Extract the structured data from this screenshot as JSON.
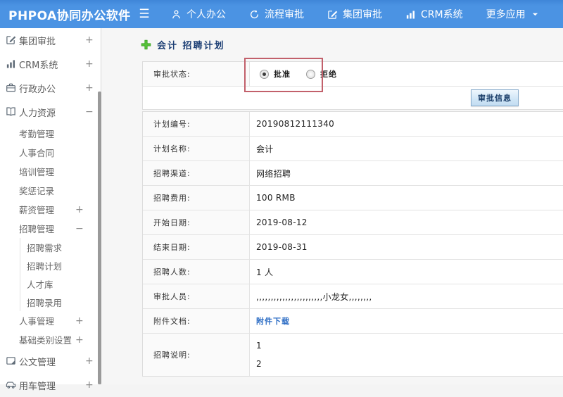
{
  "topbar": {
    "logo": "PHPOA协同办公软件",
    "items": [
      {
        "name": "personal-office",
        "label": "个人办公",
        "icon": "person-icon"
      },
      {
        "name": "workflow-approval",
        "label": "流程审批",
        "icon": "process-icon"
      },
      {
        "name": "group-approval",
        "label": "集团审批",
        "icon": "edit-square-icon"
      },
      {
        "name": "crm-system",
        "label": "CRM系统",
        "icon": "bar-chart-icon"
      },
      {
        "name": "more-apps",
        "label": "更多应用",
        "icon": "",
        "caret": true
      }
    ]
  },
  "sidebar": {
    "items": [
      {
        "name": "group-approval",
        "label": "集团审批",
        "icon": "edit-square-icon",
        "toggle": "+",
        "level": 0
      },
      {
        "name": "crm-system",
        "label": "CRM系统",
        "icon": "bar-chart-icon",
        "toggle": "+",
        "level": 0
      },
      {
        "name": "administration",
        "label": "行政办公",
        "icon": "briefcase-icon",
        "toggle": "+",
        "level": 0
      },
      {
        "name": "human-resources",
        "label": "人力资源",
        "icon": "book-icon",
        "toggle": "-",
        "level": 0
      },
      {
        "name": "attendance-mgmt",
        "label": "考勤管理",
        "level": 1
      },
      {
        "name": "hr-contract",
        "label": "人事合同",
        "level": 1
      },
      {
        "name": "training-mgmt",
        "label": "培训管理",
        "level": 1
      },
      {
        "name": "reward-records",
        "label": "奖惩记录",
        "level": 1
      },
      {
        "name": "salary-mgmt",
        "label": "薪资管理",
        "toggle": "+",
        "level": 1
      },
      {
        "name": "recruit-mgmt",
        "label": "招聘管理",
        "toggle": "-",
        "level": 1
      },
      {
        "name": "recruit-demand",
        "label": "招聘需求",
        "level": 2
      },
      {
        "name": "recruit-plan",
        "label": "招聘计划",
        "level": 2
      },
      {
        "name": "talent-pool",
        "label": "人才库",
        "level": 2
      },
      {
        "name": "recruit-hiring",
        "label": "招聘录用",
        "level": 2
      },
      {
        "name": "personnel-mgmt",
        "label": "人事管理",
        "toggle": "+",
        "level": 1
      },
      {
        "name": "base-category",
        "label": "基础类别设置",
        "toggle": "+",
        "level": 1
      },
      {
        "name": "document-mgmt",
        "label": "公文管理",
        "icon": "document-icon",
        "toggle": "+",
        "level": 0
      },
      {
        "name": "vehicle-mgmt",
        "label": "用车管理",
        "icon": "car-icon",
        "toggle": "+",
        "level": 0
      }
    ]
  },
  "main": {
    "title": "会计 招聘计划",
    "approval": {
      "label": "审批状态:",
      "options": [
        {
          "name": "approve",
          "label": "批准",
          "checked": true
        },
        {
          "name": "reject",
          "label": "拒绝",
          "checked": false
        }
      ],
      "button_label": "审批信息"
    },
    "fields": [
      {
        "name": "plan-no",
        "label": "计划编号:",
        "value": "20190812111340"
      },
      {
        "name": "plan-name",
        "label": "计划名称:",
        "value": "会计"
      },
      {
        "name": "channel",
        "label": "招聘渠道:",
        "value": "网络招聘"
      },
      {
        "name": "cost",
        "label": "招聘费用:",
        "value": "100 RMB"
      },
      {
        "name": "start-date",
        "label": "开始日期:",
        "value": "2019-08-12"
      },
      {
        "name": "end-date",
        "label": "结束日期:",
        "value": "2019-08-31"
      },
      {
        "name": "headcount",
        "label": "招聘人数:",
        "value": "1 人"
      },
      {
        "name": "approvers",
        "label": "审批人员:",
        "value": ",,,,,,,,,,,,,,,,,,,,,,,小龙女,,,,,,,,"
      },
      {
        "name": "attachment",
        "label": "附件文档:",
        "value": "附件下载",
        "link": true
      },
      {
        "name": "description",
        "label": "招聘说明:",
        "value": "1\n2",
        "tall": true
      }
    ]
  },
  "colors": {
    "topbar_blue": "#4b93e3",
    "title_navy": "#1c3e74",
    "annotation_red": "#c2606b",
    "link_blue": "#2b6cc4",
    "plus_green": "#57c239"
  }
}
